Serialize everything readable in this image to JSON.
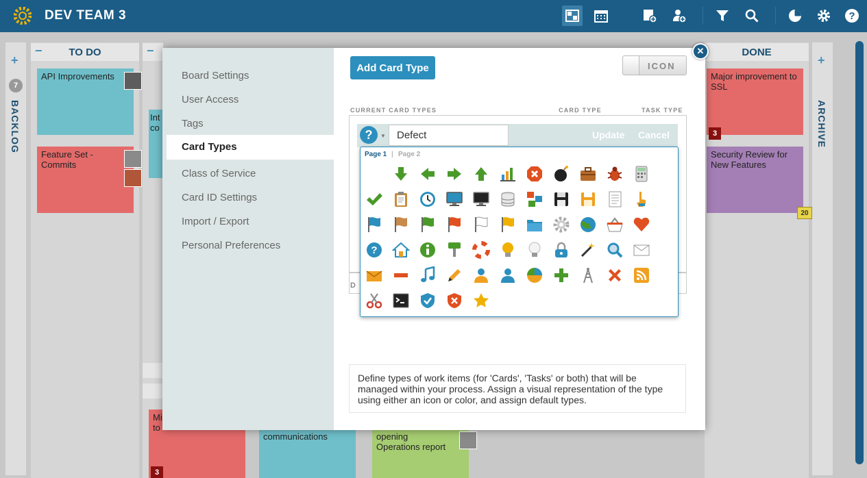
{
  "header": {
    "title": "DEV TEAM 3"
  },
  "board": {
    "lanes": {
      "backlog": "BACKLOG",
      "archive": "ARCHIVE",
      "todo": "TO DO",
      "done": "DONE"
    },
    "backlog_count": "7",
    "cards": {
      "api": "API Improvements",
      "feature": "Feature Set - Commits",
      "int_a": "Int",
      "int_b": "co",
      "major": "Major improvement to SSL",
      "major_badge": "3",
      "security": "Security Review for New Features",
      "security_date": "20",
      "bottom_a1": "Mi",
      "bottom_a2": "to",
      "bottom_a_badge": "3",
      "bottom_b": "communications",
      "bottom_c": "opening Operations report"
    }
  },
  "settings": {
    "menu": [
      "Board Settings",
      "User Access",
      "Tags",
      "Card Types",
      "Class of Service",
      "Card ID Settings",
      "Import / Export",
      "Personal Preferences"
    ],
    "selected": "Card Types",
    "add_button": "Add Card Type",
    "toggle_label": "ICON",
    "col_current": "CURRENT CARD TYPES",
    "col_card": "CARD TYPE",
    "col_task": "TASK TYPE",
    "edit_name": "Defect",
    "update": "Update",
    "cancel": "Cancel",
    "default_label": "D",
    "description": "Define types of work items (for 'Cards', 'Tasks' or both) that will be managed within your process. Assign a visual representation of the type using either an icon or color, and assign default types."
  },
  "icon_picker": {
    "page1": "Page 1",
    "sep": "|",
    "page2": "Page 2",
    "icons": [
      [
        "blank",
        "arrow-down-icon",
        "arrow-left-icon",
        "arrow-right-icon",
        "arrow-up-icon",
        "bar-chart-icon",
        "stop-icon",
        "bomb-icon",
        "briefcase-icon",
        "bug-icon",
        "calculator-icon"
      ],
      [
        "checkmark-icon",
        "clipboard-icon",
        "clock-icon",
        "monitor-icon",
        "monitor-dark-icon",
        "database-icon",
        "diagram-icon",
        "floppy-icon",
        "floppy-orange-icon",
        "document-icon",
        "pointer-icon"
      ],
      [
        "flag-blue-icon",
        "flag-orange-icon",
        "flag-green-icon",
        "flag-red-icon",
        "flag-white-icon",
        "flag-yellow-icon",
        "folder-icon",
        "gear-icon",
        "globe-icon",
        "basket-icon",
        "heart-icon"
      ],
      [
        "help-icon",
        "home-icon",
        "info-icon",
        "paint-icon",
        "lifebuoy-icon",
        "lightbulb-on-icon",
        "lightbulb-off-icon",
        "lock-icon",
        "magic-wand-icon",
        "magnifier-icon",
        "mail-icon"
      ],
      [
        "mail-open-icon",
        "minus-icon",
        "music-icon",
        "pencil-icon",
        "user-icon",
        "user-blue-icon",
        "pie-icon",
        "plus-icon",
        "tower-icon",
        "cross-icon",
        "rss-icon"
      ],
      [
        "scissors-icon",
        "terminal-icon",
        "shield-blue-icon",
        "shield-red-icon",
        "star-icon"
      ]
    ]
  },
  "colors": {
    "brand": "#1b5d87",
    "accent": "#2c8fbd",
    "card_blue": "#6fbfca",
    "card_red": "#e46a6a",
    "card_purple": "#a47fb5",
    "card_green": "#a6cd72"
  }
}
